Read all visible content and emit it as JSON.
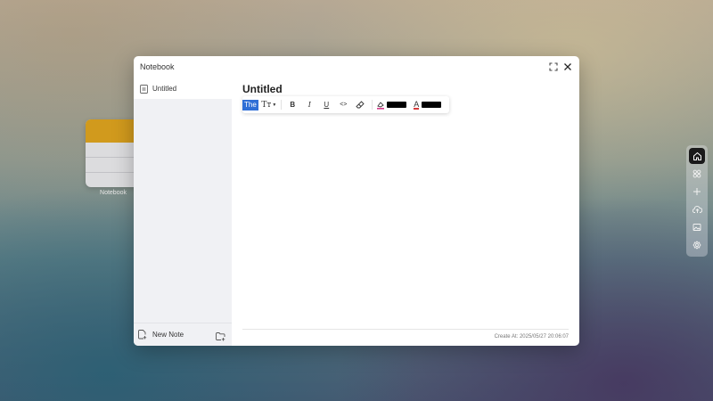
{
  "desktop": {
    "icons": [
      {
        "label": "Notebook",
        "icon": "notebook-icon"
      }
    ]
  },
  "window": {
    "title": "Notebook",
    "controls": {
      "maximize_icon": "maximize-icon",
      "close_icon": "close-icon"
    }
  },
  "sidebar": {
    "notes": [
      {
        "label": "Untitled",
        "icon": "note-file-icon",
        "selected": true
      }
    ],
    "footer": {
      "new_note_label": "New Note",
      "new_note_icon": "new-note-icon",
      "folder_icon": "new-folder-icon"
    }
  },
  "editor": {
    "title": "Untitled",
    "selected_text": "The",
    "toolbar": {
      "text_style_label": "Tт",
      "bold_label": "B",
      "italic_label": "I",
      "underline_label": "U",
      "code_label": "<>",
      "highlight_color": "#000000",
      "text_color": "#000000",
      "font_color_label": "A"
    },
    "created_at": "Create At: 2025/05/27 20:06:07"
  },
  "dock": {
    "items": [
      {
        "icon": "home-icon",
        "active": true
      },
      {
        "icon": "apps-icon",
        "active": false
      },
      {
        "icon": "add-icon",
        "active": false
      },
      {
        "icon": "upload-icon",
        "active": false
      },
      {
        "icon": "image-icon",
        "active": false
      },
      {
        "icon": "settings-icon",
        "active": false
      }
    ]
  },
  "colors": {
    "accent": "#2f6fd6",
    "note_icon_header": "#d19a1d",
    "dock_active": "#1a1a1a"
  }
}
